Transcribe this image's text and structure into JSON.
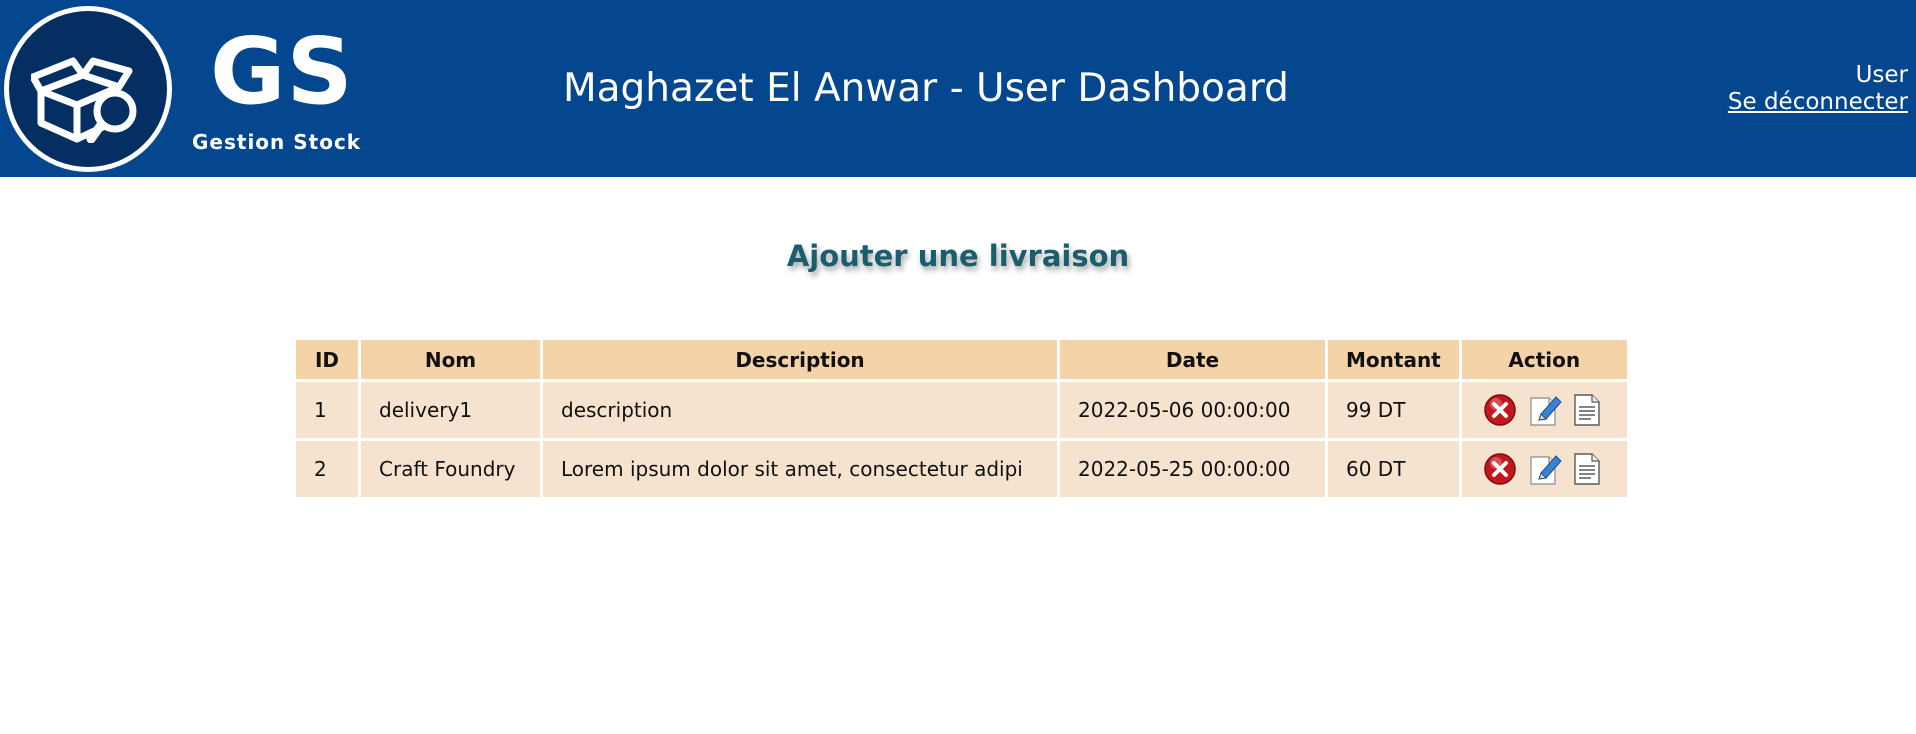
{
  "header": {
    "logo_text": "GS",
    "logo_subtitle": "Gestion Stock",
    "title": "Maghazet El Anwar - User Dashboard",
    "user_label": "User",
    "logout_label": "Se déconnecter",
    "background": "#05478f"
  },
  "main": {
    "section_title": "Ajouter une livraison"
  },
  "table": {
    "headers": {
      "id": "ID",
      "nom": "Nom",
      "description": "Description",
      "date": "Date",
      "montant": "Montant",
      "action": "Action"
    },
    "rows": [
      {
        "id": "1",
        "nom": "delivery1",
        "description": "description",
        "date": "2022-05-06 00:00:00",
        "montant": "99 DT",
        "actions": [
          "delete-icon",
          "edit-icon",
          "document-icon"
        ]
      },
      {
        "id": "2",
        "nom": "Craft Foundry",
        "description": "Lorem ipsum dolor sit amet, consectetur adipi",
        "date": "2022-05-25 00:00:00",
        "montant": "60 DT",
        "actions": [
          "delete-icon",
          "edit-icon",
          "document-icon"
        ]
      }
    ]
  }
}
